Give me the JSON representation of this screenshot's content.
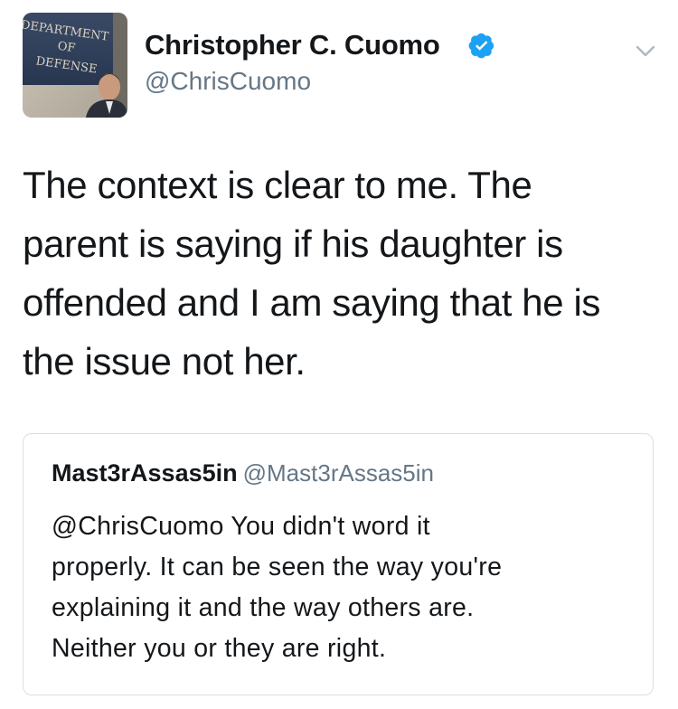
{
  "tweet": {
    "author": {
      "display_name": "Christopher C. Cuomo",
      "username": "@ChrisCuomo",
      "verified": true,
      "avatar_sign_text": "DEPARTMENT OF DEFENSE"
    },
    "text": "The context is clear to me.  The\nparent is  saying if his daughter is\noffended and I am saying that he is\nthe issue not her."
  },
  "quoted_tweet": {
    "display_name": "Mast3rAssas5in",
    "username": "@Mast3rAssas5in",
    "text": "@ChrisCuomo You didn't word it\nproperly. It can be seen the way you're\nexplaining it and the way others are.\nNeither you or they are right."
  },
  "icons": {
    "verified": "verified-badge-icon",
    "menu": "chevron-down-icon"
  },
  "colors": {
    "text": "#14171a",
    "secondary": "#657786",
    "verified": "#1da1f2",
    "border": "#dadfe3",
    "caret": "#aab8c2"
  }
}
